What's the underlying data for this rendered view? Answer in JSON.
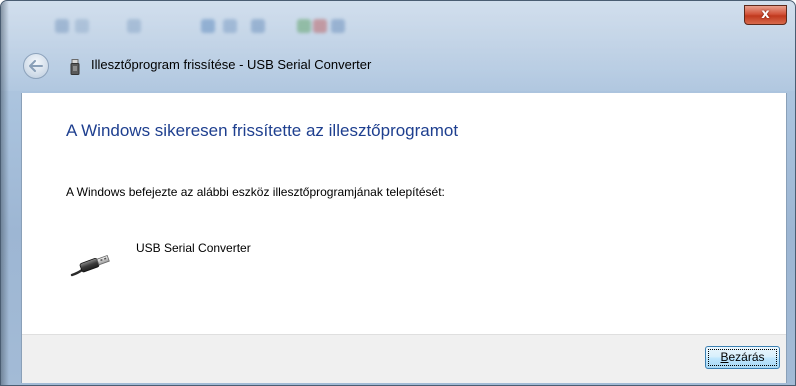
{
  "window": {
    "title": "Illesztőprogram frissítése - USB Serial Converter",
    "close_glyph": "x"
  },
  "icons": {
    "back": "back-arrow-icon",
    "title_device": "usb-device-icon",
    "device": "usb-plug-icon"
  },
  "content": {
    "heading": "A Windows sikeresen frissítette az illesztőprogramot",
    "description": "A Windows befejezte az alábbi eszköz illesztőprogramjának telepítését:",
    "device_name": "USB Serial Converter"
  },
  "footer": {
    "close_button_accel": "B",
    "close_button_rest": "ezárás"
  },
  "colors": {
    "heading": "#1e3f8f",
    "titlebar": "#a9c2dd",
    "footer": "#f0f0f0"
  }
}
